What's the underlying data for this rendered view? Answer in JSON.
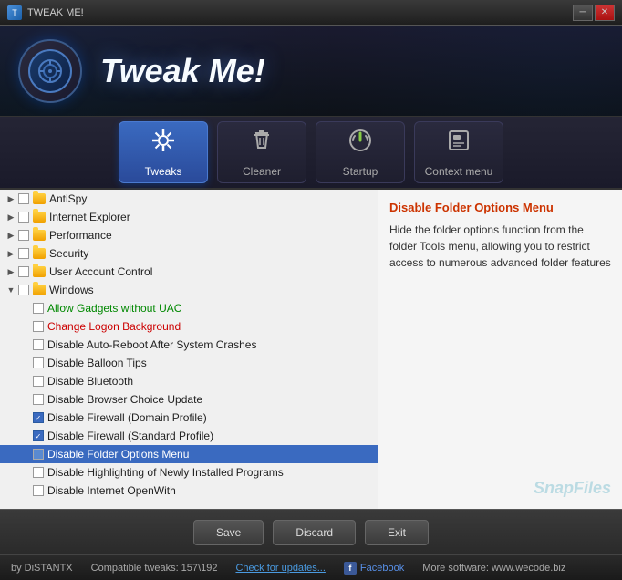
{
  "titleBar": {
    "title": "TWEAK ME!",
    "minBtn": "─",
    "closeBtn": "✕"
  },
  "header": {
    "logoSymbol": "⚙",
    "appTitle": "Tweak Me!"
  },
  "tabs": [
    {
      "id": "tweaks",
      "label": "Tweaks",
      "icon": "⚙",
      "active": true
    },
    {
      "id": "cleaner",
      "label": "Cleaner",
      "icon": "🗑",
      "active": false
    },
    {
      "id": "startup",
      "label": "Startup",
      "icon": "⏻",
      "active": false
    },
    {
      "id": "context-menu",
      "label": "Context menu",
      "icon": "🖥",
      "active": false
    }
  ],
  "tree": {
    "items": [
      {
        "id": "antispy",
        "label": "AntiSpy",
        "level": 0,
        "type": "parent",
        "expanded": false,
        "checked": false
      },
      {
        "id": "ie",
        "label": "Internet Explorer",
        "level": 0,
        "type": "parent",
        "expanded": false,
        "checked": false
      },
      {
        "id": "performance",
        "label": "Performance",
        "level": 0,
        "type": "parent",
        "expanded": false,
        "checked": false
      },
      {
        "id": "security",
        "label": "Security",
        "level": 0,
        "type": "parent",
        "expanded": false,
        "checked": false
      },
      {
        "id": "uac",
        "label": "User Account Control",
        "level": 0,
        "type": "parent",
        "expanded": false,
        "checked": false
      },
      {
        "id": "windows",
        "label": "Windows",
        "level": 0,
        "type": "parent",
        "expanded": true,
        "checked": false
      },
      {
        "id": "allow-gadgets",
        "label": "Allow Gadgets without UAC",
        "level": 1,
        "type": "leaf",
        "checked": false,
        "color": "green"
      },
      {
        "id": "change-logon",
        "label": "Change Logon Background",
        "level": 1,
        "type": "leaf",
        "checked": false,
        "color": "red"
      },
      {
        "id": "disable-autoreboot",
        "label": "Disable Auto-Reboot After System Crashes",
        "level": 1,
        "type": "leaf",
        "checked": false,
        "color": "normal"
      },
      {
        "id": "disable-balloon",
        "label": "Disable Balloon Tips",
        "level": 1,
        "type": "leaf",
        "checked": false,
        "color": "normal"
      },
      {
        "id": "disable-bluetooth",
        "label": "Disable Bluetooth",
        "level": 1,
        "type": "leaf",
        "checked": false,
        "color": "normal"
      },
      {
        "id": "disable-browser-choice",
        "label": "Disable Browser Choice Update",
        "level": 1,
        "type": "leaf",
        "checked": false,
        "color": "normal"
      },
      {
        "id": "disable-firewall-domain",
        "label": "Disable Firewall (Domain Profile)",
        "level": 1,
        "type": "leaf",
        "checked": true,
        "color": "normal"
      },
      {
        "id": "disable-firewall-standard",
        "label": "Disable Firewall (Standard Profile)",
        "level": 1,
        "type": "leaf",
        "checked": true,
        "color": "normal"
      },
      {
        "id": "disable-folder-options",
        "label": "Disable Folder Options Menu",
        "level": 1,
        "type": "leaf",
        "checked": false,
        "color": "normal",
        "selected": true
      },
      {
        "id": "disable-highlighting",
        "label": "Disable Highlighting of Newly Installed Programs",
        "level": 1,
        "type": "leaf",
        "checked": false,
        "color": "normal"
      },
      {
        "id": "disable-internet-openwith",
        "label": "Disable Internet OpenWith",
        "level": 1,
        "type": "leaf",
        "checked": false,
        "color": "normal"
      }
    ]
  },
  "infoPanel": {
    "title": "Disable Folder Options Menu",
    "description": "Hide the folder options function from the folder Tools menu, allowing you to restrict access to numerous advanced folder features",
    "watermark": "SnapFiles"
  },
  "buttons": {
    "save": "Save",
    "discard": "Discard",
    "exit": "Exit"
  },
  "statusBar": {
    "credit": "by DiSTANTX",
    "compatible": "Compatible tweaks: 157\\192",
    "checkUpdates": "Check for updates...",
    "facebook": "Facebook",
    "moreSoftware": "More software: www.wecode.biz"
  }
}
